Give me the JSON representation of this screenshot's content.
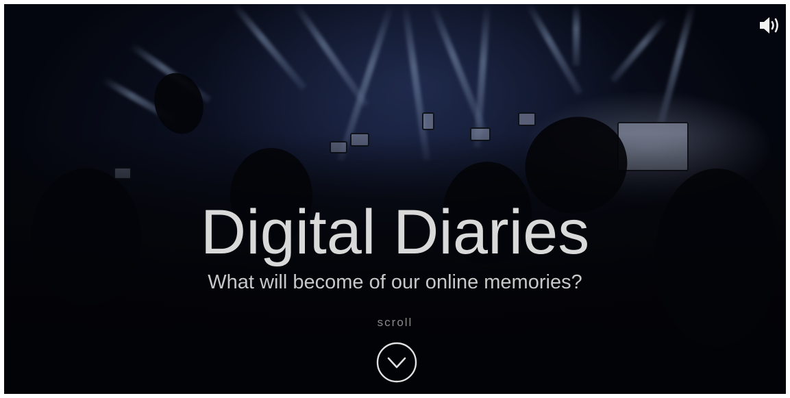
{
  "hero": {
    "title": "Digital Diaries",
    "subtitle": "What will become of our online memories?",
    "scroll_label": "scroll"
  },
  "icons": {
    "sound": "speaker-volume-icon",
    "scroll": "chevron-down-circle-icon"
  },
  "colors": {
    "title_text": "#d9d9d9",
    "subtitle_text": "#c8c8c8",
    "scroll_text": "#8a8a8a",
    "background_dark": "#0a0f1e",
    "stage_light": "#aabeea"
  }
}
